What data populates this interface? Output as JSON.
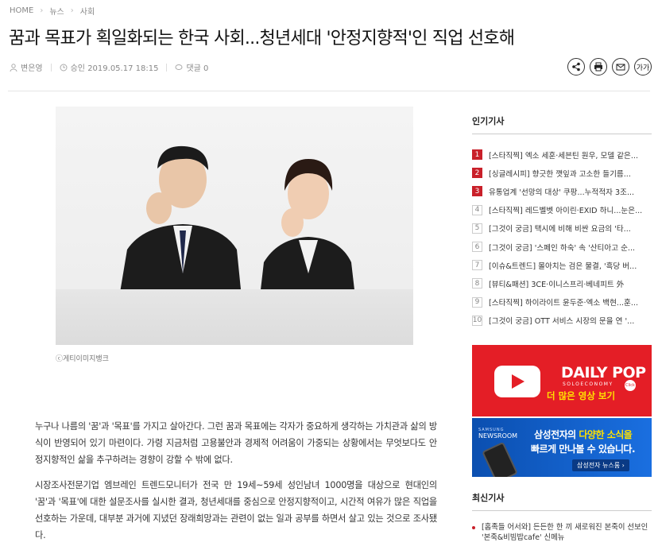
{
  "breadcrumb": {
    "home": "HOME",
    "section": "뉴스",
    "subsection": "사회"
  },
  "article": {
    "title": "꿈과 목표가 획일화되는 한국 사회...청년세대 '안정지향적'인 직업 선호해",
    "author": "변은영",
    "approved": "승인 2019.05.17 18:15",
    "comments": "댓글 0",
    "caption": "ⓒ게티이미지뱅크",
    "paragraphs": [
      "누구나 나름의 '꿈'과 '목표'를 가지고 살아간다. 그런 꿈과 목표에는 각자가 중요하게 생각하는 가치관과 삶의 방식이 반영되어 있기 마련이다. 가령 지금처럼 고용불안과 경제적 어려움이 가중되는 상황에서는 무엇보다도 안정지향적인 삶을 추구하려는 경향이 강할 수 밖에 없다.",
      "시장조사전문기업 엠브레인 트렌드모니터가 전국 만 19세~59세 성인남녀 1000명을 대상으로 현대인의 '꿈'과 '목표'에 대한 설문조사를 실시한 결과, 청년세대를 중심으로 안정지향적이고, 시간적 여유가 많은 직업을 선호하는 가운데, 대부분 과거에 지녔던 장래희망과는 관련이 없는 일과 공부를 하면서 살고 있는 것으로 조사됐다."
    ]
  },
  "share": {
    "font_label": "가가"
  },
  "sidebar": {
    "popular_heading": "인기기사",
    "popular": [
      {
        "rank": "1",
        "text": "[스타직찍] 엑소 세훈·세븐틴 원우, 모델 같은..."
      },
      {
        "rank": "2",
        "text": "[싱글레시피] 향긋한 깻잎과 고소한 들기름..."
      },
      {
        "rank": "3",
        "text": "유통업계 '선망의 대상' 쿠팡...누적적자 3조..."
      },
      {
        "rank": "4",
        "text": "[스타직찍] 레드벨벳 아이린·EXID 하니...눈은..."
      },
      {
        "rank": "5",
        "text": "[그것이 궁금] 택시에 비해 비싼 요금의 '타..."
      },
      {
        "rank": "6",
        "text": "[그것이 궁금] '스페인 하숙' 속 '산티아고 순..."
      },
      {
        "rank": "7",
        "text": "[이슈&트렌드] 몰아치는 검은 물결, '흑당 버..."
      },
      {
        "rank": "8",
        "text": "[뷰티&패션] 3CE·이니스프리·베네피트 外"
      },
      {
        "rank": "9",
        "text": "[스타직찍] 하이라이트 윤두준·엑소 백현...훈..."
      },
      {
        "rank": "10",
        "text": "[그것이 궁금] OTT 서비스 시장의 문을 연 '..."
      }
    ],
    "latest_heading": "최신기사",
    "latest": [
      {
        "text": "[홈족들 어서와] 든든한 한 끼 새로워진 본죽이 선보인 '본죽&비빔밥cafe' 신메뉴"
      }
    ]
  },
  "ads": {
    "dailypop": {
      "title": "DAILY POP",
      "sub": "SOLOECONOMY",
      "cta": "더 많은 영상 보기",
      "badge": "Click"
    },
    "samsung": {
      "brand": "SAMSUNG",
      "newsroom": "NEWSROOM",
      "line1_a": "삼성전자의 ",
      "line1_b": "다양한 소식을",
      "line2": "빠르게 만나볼 수 있습니다.",
      "button": "삼성전자 뉴스룸 ›"
    }
  }
}
